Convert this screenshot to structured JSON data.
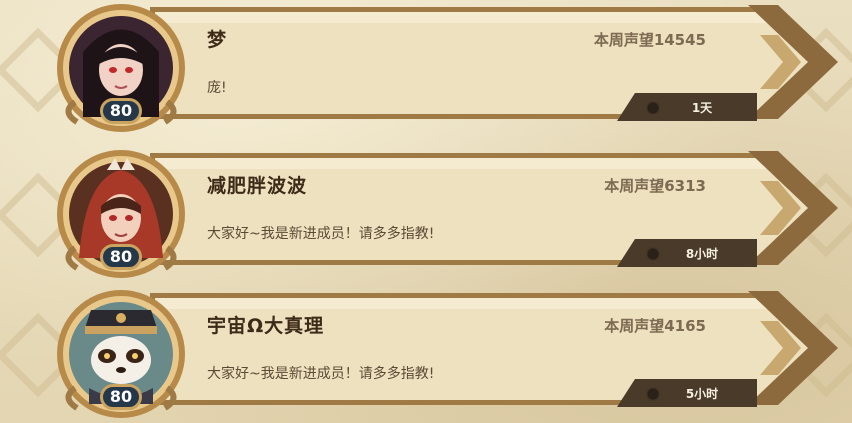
{
  "score_label": "本周声望",
  "members": [
    {
      "name": "梦",
      "score_text": "本周声望14545",
      "message": "庞!",
      "level": "80",
      "last_online": "1天",
      "avatar_icon": "female-hero-portrait-dark-hair"
    },
    {
      "name": "减肥胖波波",
      "score_text": "本周声望6313",
      "message": "大家好~我是新进成员！请多多指教!",
      "level": "80",
      "last_online": "8小时",
      "avatar_icon": "female-hero-portrait-red-hood"
    },
    {
      "name": "宇宙Ω大真理",
      "score_text": "本周声望4165",
      "message": "大家好~我是新进成员！请多多指教!",
      "level": "80",
      "last_online": "5小时",
      "avatar_icon": "panda-officer-portrait"
    }
  ],
  "colors": {
    "parchment": "#ede1bf",
    "frame_gold": "#a07a45",
    "badge_navy": "#25384a",
    "text_dark": "#3d2a18",
    "text_muted": "#7d6a52"
  }
}
